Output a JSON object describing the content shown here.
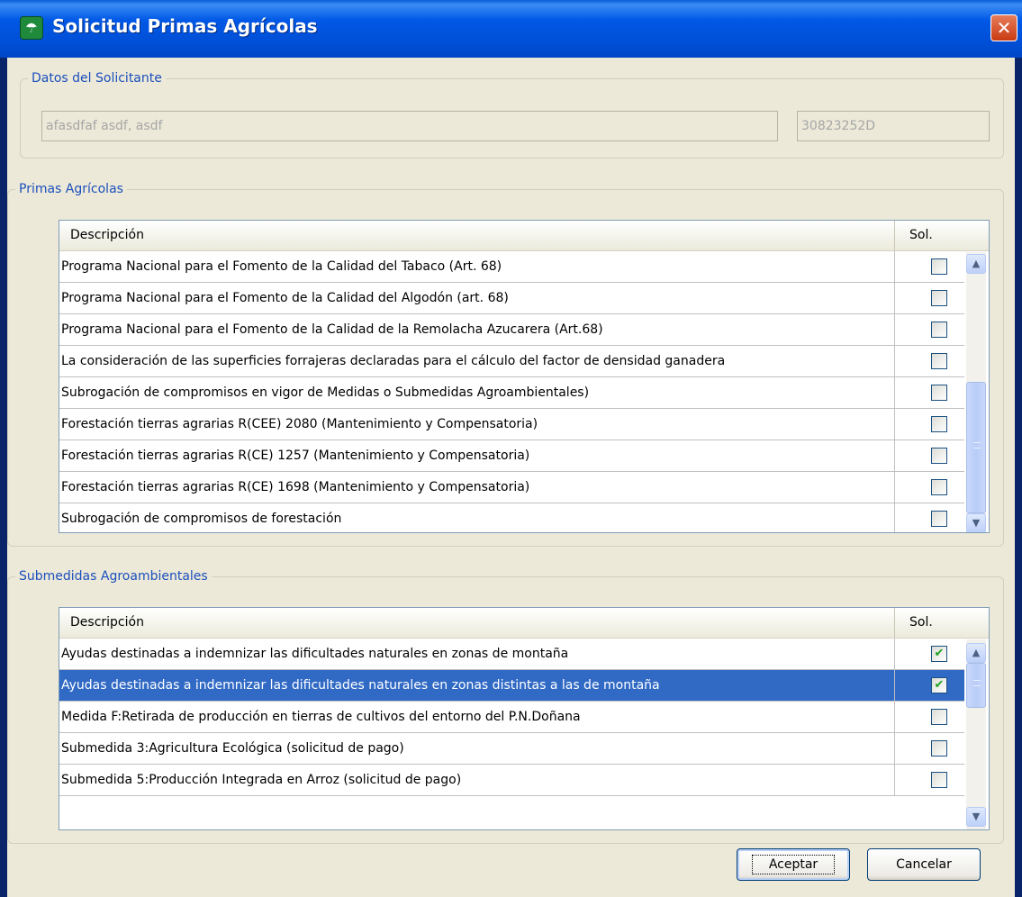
{
  "window": {
    "title": "Solicitud Primas Agrícolas",
    "close_label": "✕"
  },
  "solicitante": {
    "legend": "Datos del Solicitante",
    "nombre": "afasdfaf asdf, asdf",
    "nif": "30823252D"
  },
  "primas": {
    "legend": "Primas Agrícolas",
    "col_desc": "Descripción",
    "col_sol": "Sol.",
    "rows": [
      {
        "desc": "Programa Nacional para el Fomento de la Calidad del  Tabaco (Art. 68)",
        "checked": false
      },
      {
        "desc": "Programa Nacional para el Fomento de la Calidad del Algodón (art. 68)",
        "checked": false
      },
      {
        "desc": "Programa Nacional para el Fomento de la Calidad de la Remolacha Azucarera (Art.68)",
        "checked": false
      },
      {
        "desc": "La consideración de las superficies forrajeras declaradas para el cálculo del factor de densidad ganadera",
        "checked": false
      },
      {
        "desc": "Subrogación de compromisos en vigor de Medidas o Submedidas Agroambientales)",
        "checked": false
      },
      {
        "desc": "Forestación tierras agrarias R(CEE) 2080 (Mantenimiento y Compensatoria)",
        "checked": false
      },
      {
        "desc": "Forestación tierras agrarias R(CE) 1257 (Mantenimiento y Compensatoria)",
        "checked": false
      },
      {
        "desc": "Forestación tierras agrarias R(CE) 1698 (Mantenimiento y Compensatoria)",
        "checked": false
      },
      {
        "desc": "Subrogación de compromisos de forestación",
        "checked": false
      }
    ]
  },
  "submedidas": {
    "legend": "Submedidas Agroambientales",
    "col_desc": "Descripción",
    "col_sol": "Sol.",
    "rows": [
      {
        "desc": "Ayudas destinadas a indemnizar las dificultades naturales en zonas de montaña",
        "checked": true,
        "selected": false
      },
      {
        "desc": "Ayudas destinadas a indemnizar las dificultades naturales en zonas distintas a las de montaña",
        "checked": true,
        "selected": true
      },
      {
        "desc": "Medida F:Retirada de producción en tierras de cultivos del entorno del P.N.Doñana",
        "checked": false,
        "selected": false
      },
      {
        "desc": "Submedida 3:Agricultura Ecológica (solicitud de pago)",
        "checked": false,
        "selected": false
      },
      {
        "desc": "Submedida 5:Producción Integrada en Arroz (solicitud de pago)",
        "checked": false,
        "selected": false
      }
    ]
  },
  "buttons": {
    "aceptar": "Aceptar",
    "cancelar": "Cancelar"
  },
  "icons": {
    "window_icon": "junta-andalucia-icon",
    "scroll_up": "▲",
    "scroll_down": "▼",
    "check": "✔"
  },
  "colors": {
    "title_blue": "#0054e3",
    "selection": "#316ac5",
    "legend_text": "#1c4fbd",
    "check_green": "#21a121"
  }
}
